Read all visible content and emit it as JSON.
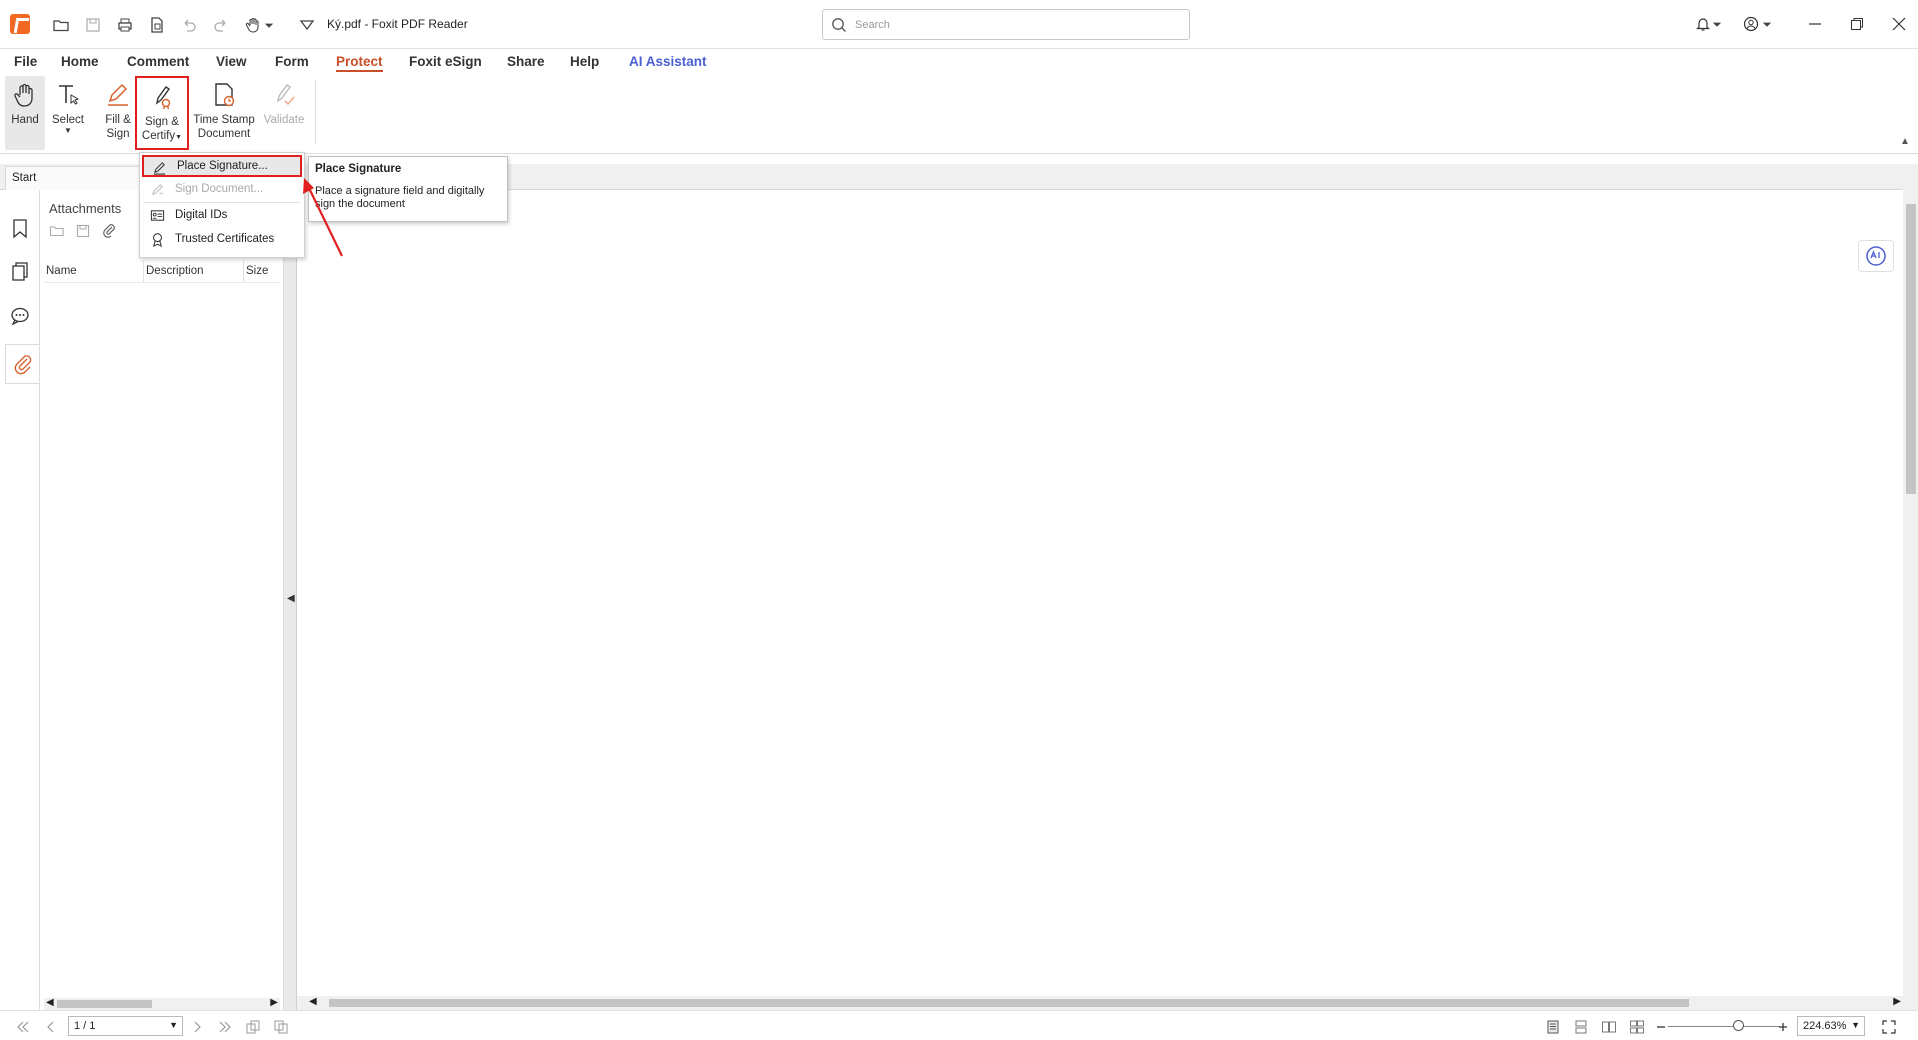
{
  "title_bar": {
    "document_title": "Ký.pdf - Foxit PDF Reader",
    "search_placeholder": "Search"
  },
  "menu": {
    "items": [
      "File",
      "Home",
      "Comment",
      "View",
      "Form",
      "Protect",
      "Foxit eSign",
      "Share",
      "Help",
      "AI Assistant"
    ],
    "active": "Protect"
  },
  "ribbon": {
    "hand": "Hand",
    "select": "Select",
    "fill_sign_1": "Fill &",
    "fill_sign_2": "Sign",
    "sign_certify_1": "Sign &",
    "sign_certify_2": "Certify",
    "time_stamp_1": "Time Stamp",
    "time_stamp_2": "Document",
    "validate": "Validate"
  },
  "tabs": {
    "start": "Start"
  },
  "attachments_panel": {
    "title": "Attachments",
    "columns": [
      "Name",
      "Description",
      "Size"
    ]
  },
  "sign_certify_menu": {
    "items": [
      "Place Signature...",
      "Sign Document...",
      "Digital IDs",
      "Trusted Certificates"
    ],
    "highlighted": "Place Signature...",
    "disabled": "Sign Document..."
  },
  "tooltip": {
    "title": "Place Signature",
    "description": "Place a signature field and digitally sign the document"
  },
  "status_bar": {
    "page": "1 / 1",
    "zoom": "224.63%"
  },
  "colors": {
    "accent": "#c84f28",
    "ai_assistant": "#4a5fd4",
    "highlight_box": "#e02020",
    "app_logo": "#f26722"
  },
  "icons": [
    "folder-open-icon",
    "save-icon",
    "print-icon",
    "new-doc-icon",
    "undo-icon",
    "redo-icon",
    "hand-icon",
    "search-icon",
    "bell-icon",
    "account-icon",
    "bookmark-icon",
    "pages-icon",
    "comment-icon",
    "paperclip-icon",
    "pen-icon",
    "signature-icon",
    "id-card-icon",
    "certificate-icon"
  ]
}
